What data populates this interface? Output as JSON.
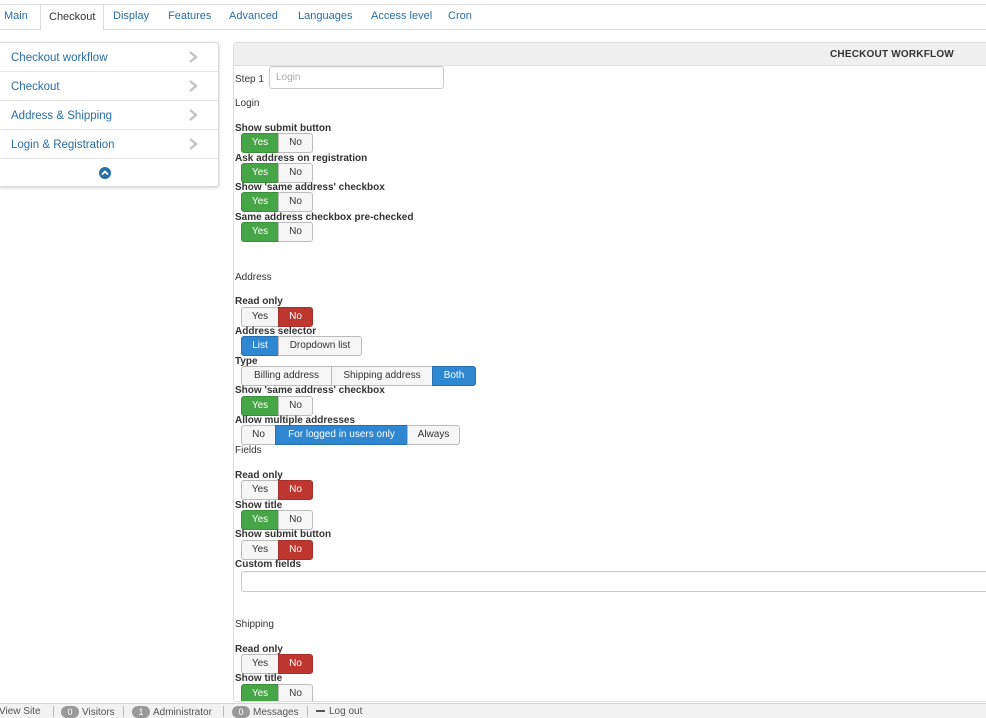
{
  "tabs": [
    {
      "label": "Main"
    },
    {
      "label": "Checkout",
      "active": true
    },
    {
      "label": "Display"
    },
    {
      "label": "Features"
    },
    {
      "label": "Advanced"
    },
    {
      "label": "Languages"
    },
    {
      "label": "Access level"
    },
    {
      "label": "Cron"
    }
  ],
  "sidebar": {
    "items": [
      {
        "label": "Checkout workflow"
      },
      {
        "label": "Checkout"
      },
      {
        "label": "Address & Shipping"
      },
      {
        "label": "Login & Registration"
      }
    ],
    "collapse_icon": "chevron-circle-up-icon"
  },
  "panel": {
    "title": "CHECKOUT WORKFLOW",
    "step_label": "Step 1",
    "step_input_placeholder": "Login",
    "sections": {
      "login": {
        "heading": "Login",
        "show_submit_button": {
          "label": "Show submit button",
          "options": [
            "Yes",
            "No"
          ]
        },
        "ask_address": {
          "label": "Ask address on registration",
          "options": [
            "Yes",
            "No"
          ]
        },
        "same_address_checkbox": {
          "label": "Show 'same address' checkbox",
          "options": [
            "Yes",
            "No"
          ]
        },
        "same_address_prechecked": {
          "label": "Same address checkbox pre-checked",
          "options": [
            "Yes",
            "No"
          ]
        }
      },
      "address": {
        "heading": "Address",
        "read_only": {
          "label": "Read only",
          "options": [
            "Yes",
            "No"
          ]
        },
        "address_selector": {
          "label": "Address selector",
          "options": [
            "List",
            "Dropdown list"
          ]
        },
        "type": {
          "label": "Type",
          "options": [
            "Billing address",
            "Shipping address",
            "Both"
          ]
        },
        "same_address_checkbox": {
          "label": "Show 'same address' checkbox",
          "options": [
            "Yes",
            "No"
          ]
        },
        "allow_multiple": {
          "label": "Allow multiple addresses",
          "options": [
            "No",
            "For logged in users only",
            "Always"
          ]
        }
      },
      "fields": {
        "heading": "Fields",
        "read_only": {
          "label": "Read only",
          "options": [
            "Yes",
            "No"
          ]
        },
        "show_title": {
          "label": "Show title",
          "options": [
            "Yes",
            "No"
          ]
        },
        "show_submit_button": {
          "label": "Show submit button",
          "options": [
            "Yes",
            "No"
          ]
        },
        "custom_fields": {
          "label": "Custom fields",
          "value": ""
        }
      },
      "shipping": {
        "heading": "Shipping",
        "read_only": {
          "label": "Read only",
          "options": [
            "Yes",
            "No"
          ]
        },
        "show_title": {
          "label": "Show title",
          "options": [
            "Yes",
            "No"
          ]
        }
      }
    }
  },
  "statusbar": {
    "view_site": "View Site",
    "visitors": {
      "count": "0",
      "label": "Visitors"
    },
    "admins": {
      "count": "1",
      "label": "Administrator"
    },
    "messages": {
      "count": "0",
      "label": "Messages"
    },
    "logout": "Log out"
  },
  "colors": {
    "yes_active": "#46a546",
    "no_active": "#bd362f",
    "selected_blue": "#2f86d1",
    "link": "#2a6ea6"
  }
}
